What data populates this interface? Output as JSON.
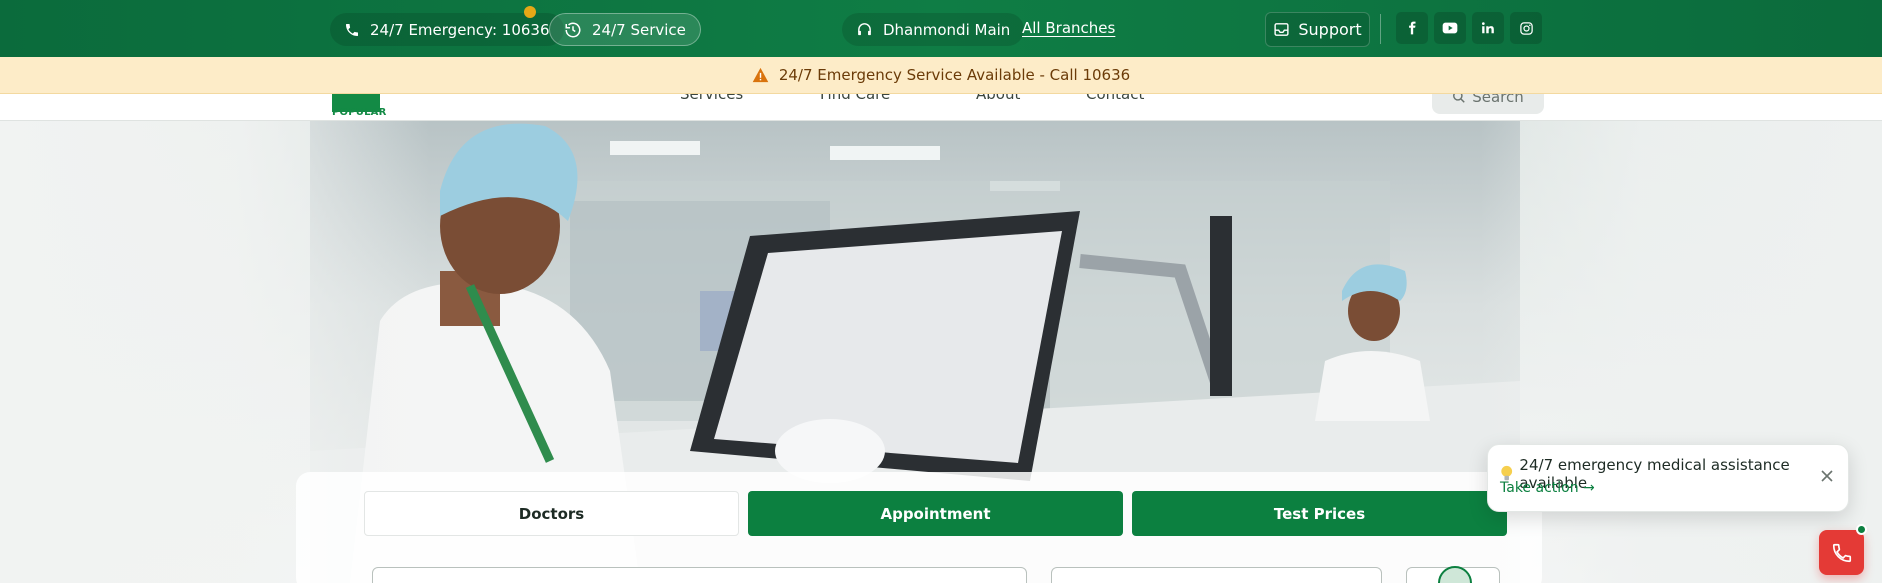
{
  "topbar": {
    "emergency_label": "24/7 Emergency: 10636",
    "service_label": "24/7 Service",
    "branch_label": "Dhanmondi Main",
    "all_branches_label": "All Branches",
    "support_label": "Support",
    "social": [
      "facebook-icon",
      "youtube-icon",
      "linkedin-icon",
      "instagram-icon"
    ]
  },
  "banner": {
    "text": "24/7 Emergency Service Available - Call 10636"
  },
  "nav": {
    "logo_text": "POPULAR",
    "items": [
      "Services",
      "Find Care",
      "About",
      "Contact"
    ],
    "search_label": "Search"
  },
  "tabs": [
    {
      "label": "Doctors",
      "active": true
    },
    {
      "label": "Appointment",
      "active": false
    },
    {
      "label": "Test Prices",
      "active": false
    }
  ],
  "toast": {
    "message": "24/7 emergency medical assistance available",
    "action": "Take action →"
  },
  "colors": {
    "brand_green": "#0c8040",
    "topbar_green": "#0f7d45",
    "banner_bg": "#fdecc8",
    "banner_text": "#6b3b08",
    "call_red": "#e43a36"
  }
}
